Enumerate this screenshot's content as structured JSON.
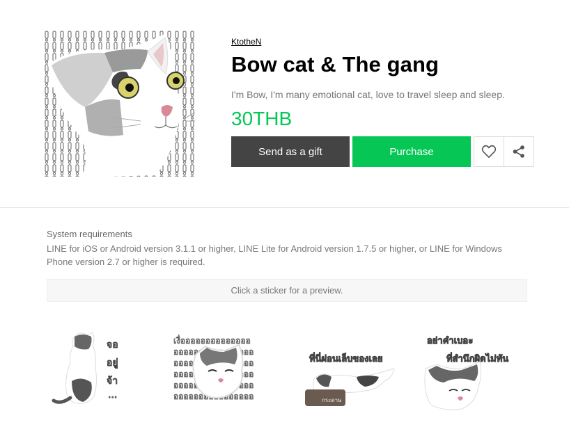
{
  "product": {
    "author": "KtotheN",
    "title": "Bow cat & The gang",
    "description": "I'm Bow, I'm many emotional cat, love to travel sleep and sleep.",
    "price": "30THB"
  },
  "actions": {
    "gift_label": "Send as a gift",
    "purchase_label": "Purchase",
    "favorite_icon": "heart-outline-icon",
    "share_icon": "share-icon"
  },
  "requirements": {
    "title": "System requirements",
    "text": "LINE for iOS or Android version 3.1.1 or higher, LINE Lite for Android version 1.7.5 or higher, or LINE for Windows Phone version 2.7 or higher is required."
  },
  "preview_hint": "Click a sticker for a preview.",
  "stickers": [
    {
      "caption_lines": [
        "จอ",
        "อยู่",
        "จ้า",
        "..."
      ]
    },
    {
      "caption_lines": [
        "เงื่ออออออออออออออ",
        "ออออออออออออออออ",
        "ออออออออออออออออ",
        "ออออออออออออออออ",
        "ออออออออออออออออ",
        "ออออออออออออออออ"
      ]
    },
    {
      "caption_lines": [
        "ที่นี่ผ่อนเล็บของเลย"
      ]
    },
    {
      "caption_lines": [
        "อย่าคำเบอะ",
        "ที่สำนึกผิดไม่ทัน"
      ]
    }
  ],
  "colors": {
    "accent": "#06c755",
    "gift_button": "#444444",
    "muted_text": "#777777"
  }
}
